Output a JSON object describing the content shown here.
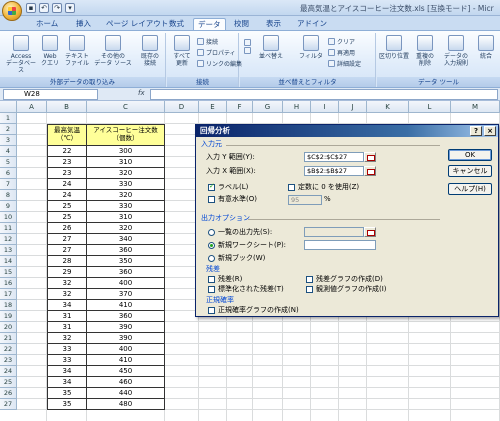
{
  "window": {
    "title": "最高気温とアイスコーヒー注文数.xls  [互換モード] - Micr"
  },
  "tabs": [
    "ホーム",
    "挿入",
    "ページ レイアウト",
    "数式",
    "データ",
    "校閲",
    "表示",
    "アドイン"
  ],
  "active_tab": "データ",
  "ribbon": {
    "groups": {
      "external": "外部データの取り込み",
      "connections": "接続",
      "sort_filter": "並べ替えとフィルタ",
      "tools": "データ ツール"
    },
    "buttons": {
      "access": "Access\nデータベース",
      "web": "Web\nクエリ",
      "text": "テキスト\nファイル",
      "other": "その他の\nデータ ソース",
      "existing": "既存の\n接続",
      "refresh": "すべて\n更新",
      "connections": "接続",
      "properties": "プロパティ",
      "edit_links": "リンクの編集",
      "sort": "並べ替え",
      "filter": "フィルタ",
      "clear": "クリア",
      "reapply": "再適用",
      "advanced": "詳細設定",
      "text_to_columns": "区切り位置",
      "remove_duplicates": "重複の\n削除",
      "validation": "データの\n入力規則",
      "consolidate": "統合"
    }
  },
  "formula_bar": {
    "name_box": "W28",
    "fx": "fx",
    "content": ""
  },
  "grid": {
    "columns": [
      "A",
      "B",
      "C",
      "D",
      "E",
      "F",
      "G",
      "H",
      "I",
      "J",
      "K",
      "L",
      "M"
    ],
    "rows": [
      "1",
      "2",
      "3",
      "4",
      "5",
      "6",
      "7",
      "8",
      "9",
      "10",
      "11",
      "12",
      "13",
      "14",
      "15",
      "16",
      "17",
      "18",
      "19",
      "20",
      "21",
      "22",
      "23",
      "24",
      "25",
      "26",
      "27"
    ],
    "table": {
      "header_b": "最高気温\n（℃）",
      "header_c": "アイスコーヒー注文数\n（個数）",
      "temps": [
        22,
        23,
        23,
        24,
        24,
        25,
        25,
        26,
        27,
        27,
        28,
        29,
        32,
        32,
        34,
        31,
        31,
        32,
        33,
        33,
        34,
        34,
        35,
        35
      ],
      "orders": [
        300,
        310,
        320,
        330,
        320,
        330,
        310,
        320,
        340,
        360,
        350,
        360,
        400,
        370,
        410,
        360,
        390,
        390,
        400,
        410,
        450,
        460,
        440,
        480
      ]
    }
  },
  "dialog": {
    "title": "回帰分析",
    "input_section": "入力元",
    "y_range_label": "入力 Y 範囲(Y):",
    "y_range_value": "$C$2:$C$27",
    "x_range_label": "入力 X 範囲(X):",
    "x_range_value": "$B$2:$B$27",
    "labels_label": "ラベル(L)",
    "labels_checked": true,
    "constant_zero_label": "定数に 0 を使用(Z)",
    "confidence_label": "有意水準(O)",
    "confidence_value": "95",
    "percent": "%",
    "output_section": "出力オプション",
    "output_range_label": "一覧の出力先(S):",
    "new_sheet_label": "新規ワークシート(P):",
    "new_book_label": "新規ブック(W)",
    "residuals_section": "残差",
    "residuals_label": "残差(R)",
    "std_residuals_label": "標準化された残差(T)",
    "residual_plots_label": "残差グラフの作成(D)",
    "line_fit_label": "観測値グラフの作成(I)",
    "normal_section": "正規確率",
    "normal_plot_label": "正規確率グラフの作成(N)",
    "ok": "OK",
    "cancel": "キャンセル",
    "help": "ヘルプ(H)",
    "help_icon": "?",
    "close_icon": "×"
  }
}
